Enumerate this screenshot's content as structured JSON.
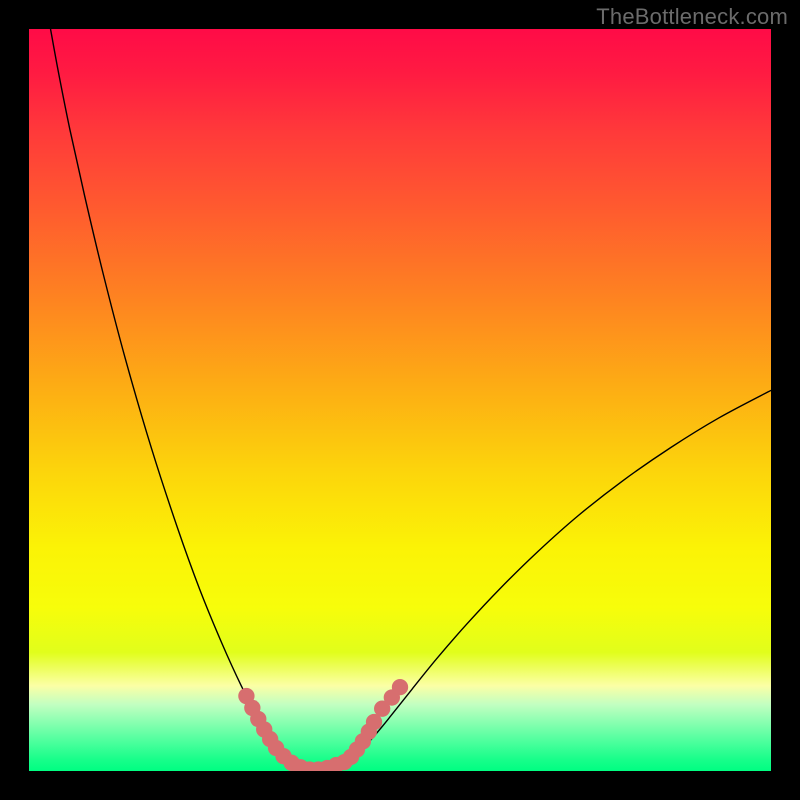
{
  "watermark": "TheBottleneck.com",
  "gradient": {
    "stops": [
      {
        "offset": 0.0,
        "color": "#ff0b47"
      },
      {
        "offset": 0.06,
        "color": "#ff1b42"
      },
      {
        "offset": 0.14,
        "color": "#ff3a3a"
      },
      {
        "offset": 0.24,
        "color": "#ff5a2f"
      },
      {
        "offset": 0.36,
        "color": "#fe8221"
      },
      {
        "offset": 0.48,
        "color": "#fdac14"
      },
      {
        "offset": 0.6,
        "color": "#fcd60b"
      },
      {
        "offset": 0.7,
        "color": "#fbf306"
      },
      {
        "offset": 0.78,
        "color": "#f7fd0a"
      },
      {
        "offset": 0.84,
        "color": "#e1fe1b"
      },
      {
        "offset": 0.885,
        "color": "#fbffa5"
      },
      {
        "offset": 0.91,
        "color": "#c3ffc1"
      },
      {
        "offset": 0.935,
        "color": "#87ffb0"
      },
      {
        "offset": 0.96,
        "color": "#4dff9d"
      },
      {
        "offset": 0.985,
        "color": "#17fe8a"
      },
      {
        "offset": 1.0,
        "color": "#00fe82"
      }
    ]
  },
  "chart_data": {
    "type": "line",
    "title": "",
    "xlabel": "",
    "ylabel": "",
    "xlim": [
      0,
      100
    ],
    "ylim": [
      0,
      100
    ],
    "series": [
      {
        "name": "bottleneck-curve",
        "points": [
          {
            "x": 2.9,
            "y": 100.0
          },
          {
            "x": 4.0,
            "y": 94.0
          },
          {
            "x": 5.5,
            "y": 86.5
          },
          {
            "x": 7.5,
            "y": 77.5
          },
          {
            "x": 10.0,
            "y": 67.0
          },
          {
            "x": 13.0,
            "y": 55.5
          },
          {
            "x": 16.5,
            "y": 43.5
          },
          {
            "x": 20.0,
            "y": 32.8
          },
          {
            "x": 23.0,
            "y": 24.5
          },
          {
            "x": 26.0,
            "y": 17.2
          },
          {
            "x": 28.6,
            "y": 11.5
          },
          {
            "x": 30.8,
            "y": 7.3
          },
          {
            "x": 32.6,
            "y": 4.2
          },
          {
            "x": 34.2,
            "y": 2.1
          },
          {
            "x": 35.6,
            "y": 0.9
          },
          {
            "x": 37.3,
            "y": 0.3
          },
          {
            "x": 39.1,
            "y": 0.2
          },
          {
            "x": 41.0,
            "y": 0.5
          },
          {
            "x": 42.8,
            "y": 1.3
          },
          {
            "x": 44.6,
            "y": 2.7
          },
          {
            "x": 46.6,
            "y": 4.8
          },
          {
            "x": 48.9,
            "y": 7.6
          },
          {
            "x": 51.6,
            "y": 11.0
          },
          {
            "x": 55.0,
            "y": 15.2
          },
          {
            "x": 59.0,
            "y": 19.8
          },
          {
            "x": 63.5,
            "y": 24.6
          },
          {
            "x": 68.5,
            "y": 29.5
          },
          {
            "x": 74.0,
            "y": 34.4
          },
          {
            "x": 80.0,
            "y": 39.1
          },
          {
            "x": 86.5,
            "y": 43.6
          },
          {
            "x": 93.0,
            "y": 47.6
          },
          {
            "x": 100.0,
            "y": 51.3
          }
        ]
      }
    ],
    "markers": [
      {
        "x": 29.3,
        "y": 10.1
      },
      {
        "x": 30.1,
        "y": 8.5
      },
      {
        "x": 30.9,
        "y": 7.0
      },
      {
        "x": 31.7,
        "y": 5.6
      },
      {
        "x": 32.5,
        "y": 4.3
      },
      {
        "x": 33.3,
        "y": 3.1
      },
      {
        "x": 34.3,
        "y": 2.0
      },
      {
        "x": 35.4,
        "y": 1.1
      },
      {
        "x": 36.6,
        "y": 0.5
      },
      {
        "x": 37.8,
        "y": 0.2
      },
      {
        "x": 39.0,
        "y": 0.2
      },
      {
        "x": 40.2,
        "y": 0.4
      },
      {
        "x": 41.4,
        "y": 0.8
      },
      {
        "x": 42.5,
        "y": 1.2
      },
      {
        "x": 43.4,
        "y": 1.9
      },
      {
        "x": 44.2,
        "y": 2.9
      },
      {
        "x": 45.0,
        "y": 4.0
      },
      {
        "x": 45.8,
        "y": 5.3
      },
      {
        "x": 46.5,
        "y": 6.6
      },
      {
        "x": 47.6,
        "y": 8.4
      },
      {
        "x": 48.9,
        "y": 9.9
      },
      {
        "x": 50.0,
        "y": 11.3
      }
    ],
    "marker_radius": 1.1
  }
}
